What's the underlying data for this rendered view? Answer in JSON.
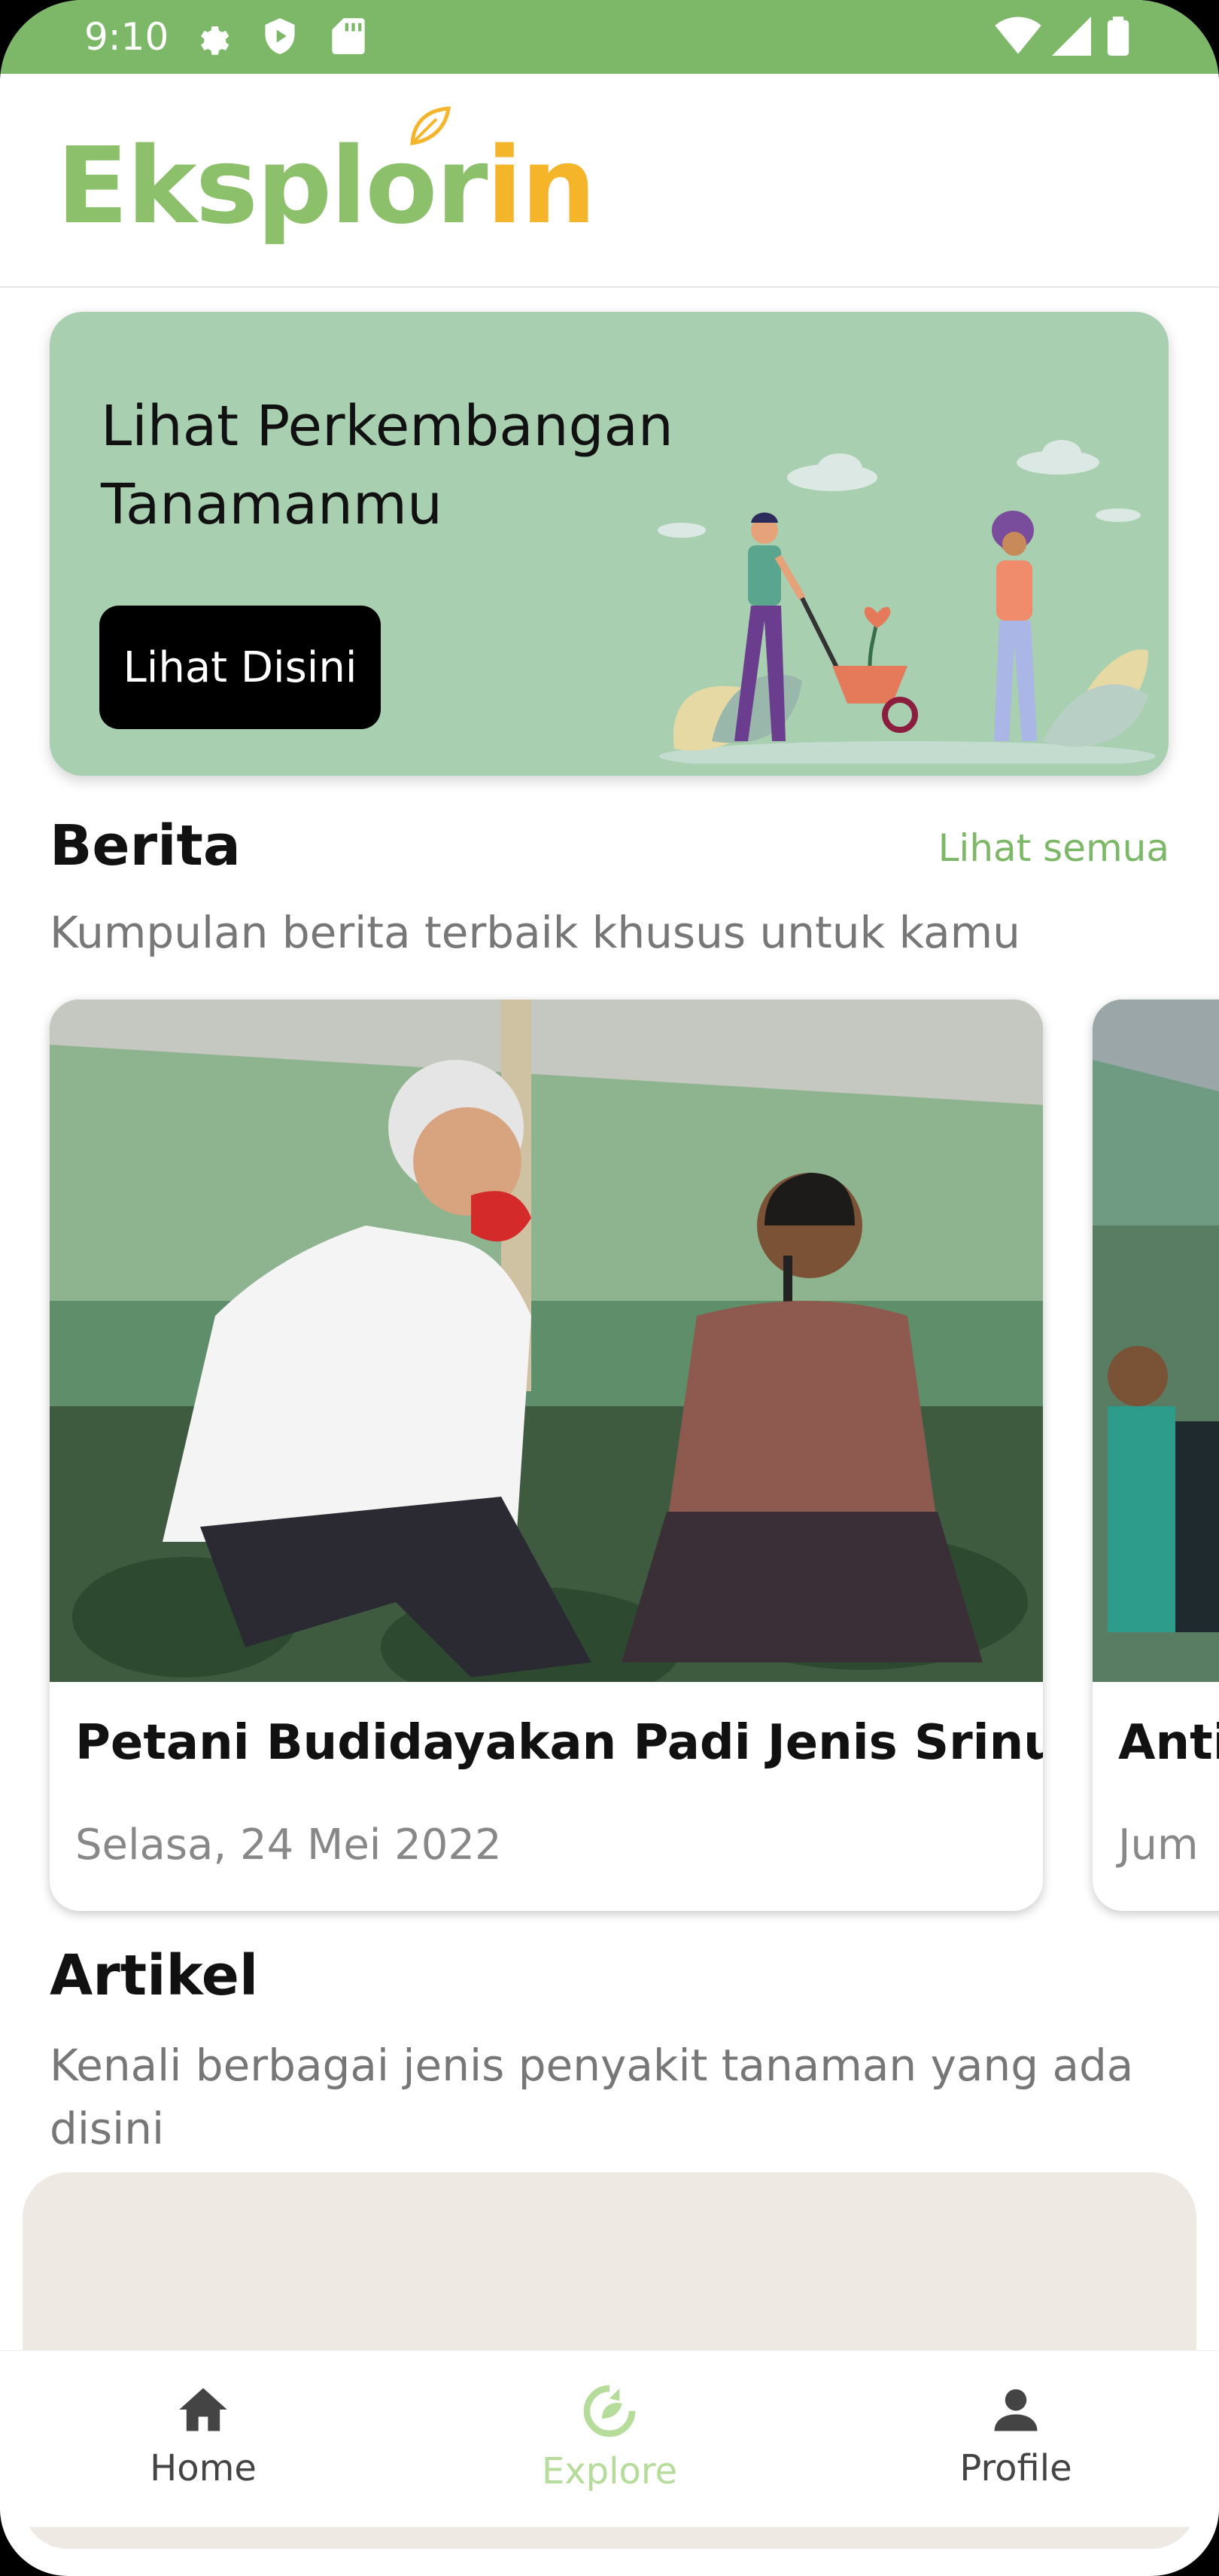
{
  "status_bar": {
    "time": "9:10",
    "icons": [
      "settings-icon",
      "play-protect-icon",
      "sd-card-icon",
      "wifi-icon",
      "signal-icon",
      "battery-icon"
    ]
  },
  "app": {
    "logo_part1": "Eksplor",
    "logo_part2": "in",
    "brand_green": "#8cc06b",
    "brand_orange": "#f4b52a"
  },
  "banner": {
    "title": "Lihat Perkembangan Tanamanmu",
    "button_label": "Lihat Disini",
    "background": "#a8d0b0"
  },
  "news": {
    "title": "Berita",
    "see_all": "Lihat semua",
    "subtitle": "Kumpulan berita terbaik khusus untuk kamu",
    "cards": [
      {
        "title": "Petani Budidayakan Padi Jenis Srinuk,",
        "date": "Selasa, 24 Mei 2022"
      },
      {
        "title": "Antis",
        "date": "Jum"
      }
    ]
  },
  "articles": {
    "title": "Artikel",
    "subtitle": "Kenali berbagai jenis penyakit tanaman yang ada disini"
  },
  "bottom_nav": {
    "active_color": "#b5dc9a",
    "inactive_color": "#444444",
    "items": [
      {
        "label": "Home",
        "icon": "home-icon",
        "active": false
      },
      {
        "label": "Explore",
        "icon": "explore-icon",
        "active": true
      },
      {
        "label": "Profile",
        "icon": "profile-icon",
        "active": false
      }
    ]
  }
}
